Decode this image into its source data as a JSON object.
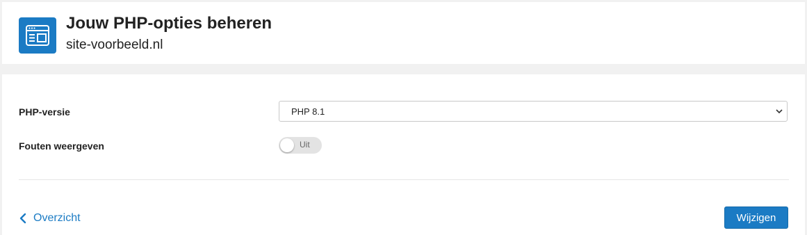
{
  "header": {
    "icon": "browser-window-icon",
    "title": "Jouw PHP-opties beheren",
    "subtitle": "site-voorbeeld.nl"
  },
  "form": {
    "php_version": {
      "label": "PHP-versie",
      "selected": "PHP 8.1"
    },
    "show_errors": {
      "label": "Fouten weergeven",
      "state_text": "Uit",
      "enabled": false
    }
  },
  "footer": {
    "back_label": "Overzicht",
    "submit_label": "Wijzigen"
  },
  "colors": {
    "accent": "#1b7bc4",
    "toggle_off": "#e3e3e3",
    "page_bg": "#f1f1f1"
  }
}
